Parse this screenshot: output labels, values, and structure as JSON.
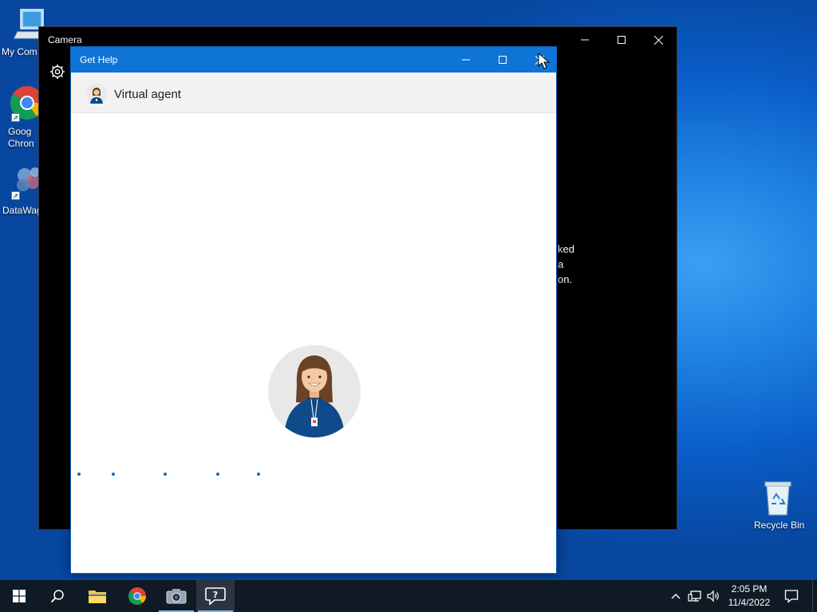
{
  "desktop": {
    "icons": [
      {
        "label": "My Com"
      },
      {
        "label": "Goog Chron"
      },
      {
        "label": "DataWag"
      }
    ],
    "recycle_bin": {
      "label": "Recycle Bin"
    }
  },
  "camera_window": {
    "title": "Camera",
    "message_lines": [
      "ked",
      "a",
      "on."
    ]
  },
  "get_help_window": {
    "title": "Get Help",
    "header": {
      "title": "Virtual agent"
    },
    "loading_dot_count": 5
  },
  "taskbar": {
    "apps": [
      {
        "name": "start",
        "icon": "windows-logo-icon"
      },
      {
        "name": "search",
        "icon": "search-icon"
      },
      {
        "name": "file-explorer",
        "icon": "folder-icon"
      },
      {
        "name": "google-chrome",
        "icon": "chrome-icon"
      },
      {
        "name": "camera",
        "icon": "camera-icon"
      },
      {
        "name": "get-help",
        "icon": "get-help-icon",
        "active": true
      }
    ],
    "clock": {
      "time": "2:05 PM",
      "date": "11/4/2022"
    }
  },
  "colors": {
    "accent_titlebar": "#0e74d6",
    "taskbar": "#101a25",
    "camera_bg": "#000000",
    "agent_shirt": "#0f4a8a"
  }
}
